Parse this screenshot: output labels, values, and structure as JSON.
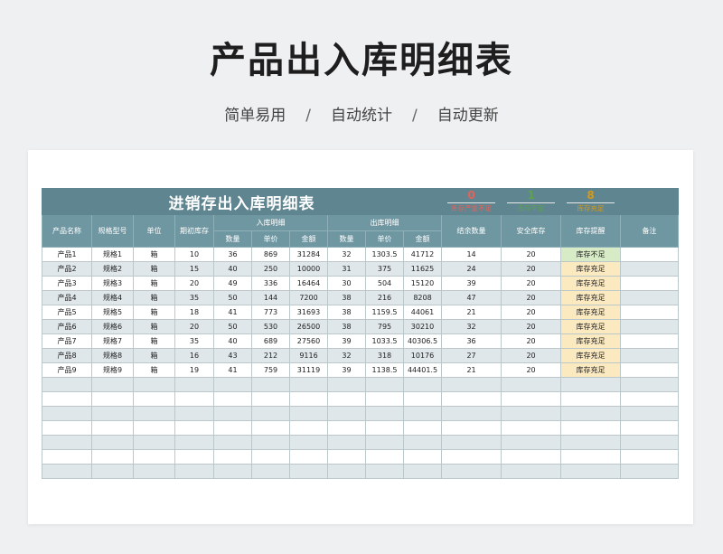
{
  "page": {
    "title": "产品出入库明细表",
    "tags": [
      "简单易用",
      "自动统计",
      "自动更新"
    ]
  },
  "sheet": {
    "title": "进销存出入库明细表",
    "stats": [
      {
        "value": "0",
        "label": "库存严重不足",
        "color": "#e0645a"
      },
      {
        "value": "1",
        "label": "库存不足",
        "color": "#5ba34d"
      },
      {
        "value": "8",
        "label": "库存充足",
        "color": "#d49a1a"
      }
    ],
    "headers": {
      "name": "产品名称",
      "spec": "规格型号",
      "unit": "单位",
      "initial": "期初库存",
      "in_group": "入库明细",
      "out_group": "出库明细",
      "qty": "数量",
      "price": "单价",
      "amount": "金额",
      "balance": "结余数量",
      "safety": "安全库存",
      "alert": "库存提醒",
      "note": "备注"
    },
    "rows": [
      [
        "产品1",
        "规格1",
        "箱",
        "10",
        "36",
        "869",
        "31284",
        "32",
        "1303.5",
        "41712",
        "14",
        "20",
        "库存不足",
        ""
      ],
      [
        "产品2",
        "规格2",
        "箱",
        "15",
        "40",
        "250",
        "10000",
        "31",
        "375",
        "11625",
        "24",
        "20",
        "库存充足",
        ""
      ],
      [
        "产品3",
        "规格3",
        "箱",
        "20",
        "49",
        "336",
        "16464",
        "30",
        "504",
        "15120",
        "39",
        "20",
        "库存充足",
        ""
      ],
      [
        "产品4",
        "规格4",
        "箱",
        "35",
        "50",
        "144",
        "7200",
        "38",
        "216",
        "8208",
        "47",
        "20",
        "库存充足",
        ""
      ],
      [
        "产品5",
        "规格5",
        "箱",
        "18",
        "41",
        "773",
        "31693",
        "38",
        "1159.5",
        "44061",
        "21",
        "20",
        "库存充足",
        ""
      ],
      [
        "产品6",
        "规格6",
        "箱",
        "20",
        "50",
        "530",
        "26500",
        "38",
        "795",
        "30210",
        "32",
        "20",
        "库存充足",
        ""
      ],
      [
        "产品7",
        "规格7",
        "箱",
        "35",
        "40",
        "689",
        "27560",
        "39",
        "1033.5",
        "40306.5",
        "36",
        "20",
        "库存充足",
        ""
      ],
      [
        "产品8",
        "规格8",
        "箱",
        "16",
        "43",
        "212",
        "9116",
        "32",
        "318",
        "10176",
        "27",
        "20",
        "库存充足",
        ""
      ],
      [
        "产品9",
        "规格9",
        "箱",
        "19",
        "41",
        "759",
        "31119",
        "39",
        "1138.5",
        "44401.5",
        "21",
        "20",
        "库存充足",
        ""
      ]
    ],
    "empty_rows": 7,
    "colors": {
      "header": "#6f97a2",
      "banner": "#5f8591",
      "stripe": "#dfe7ea",
      "alert_ok": "#fbe9c0",
      "alert_low": "#d7ebc6"
    }
  }
}
